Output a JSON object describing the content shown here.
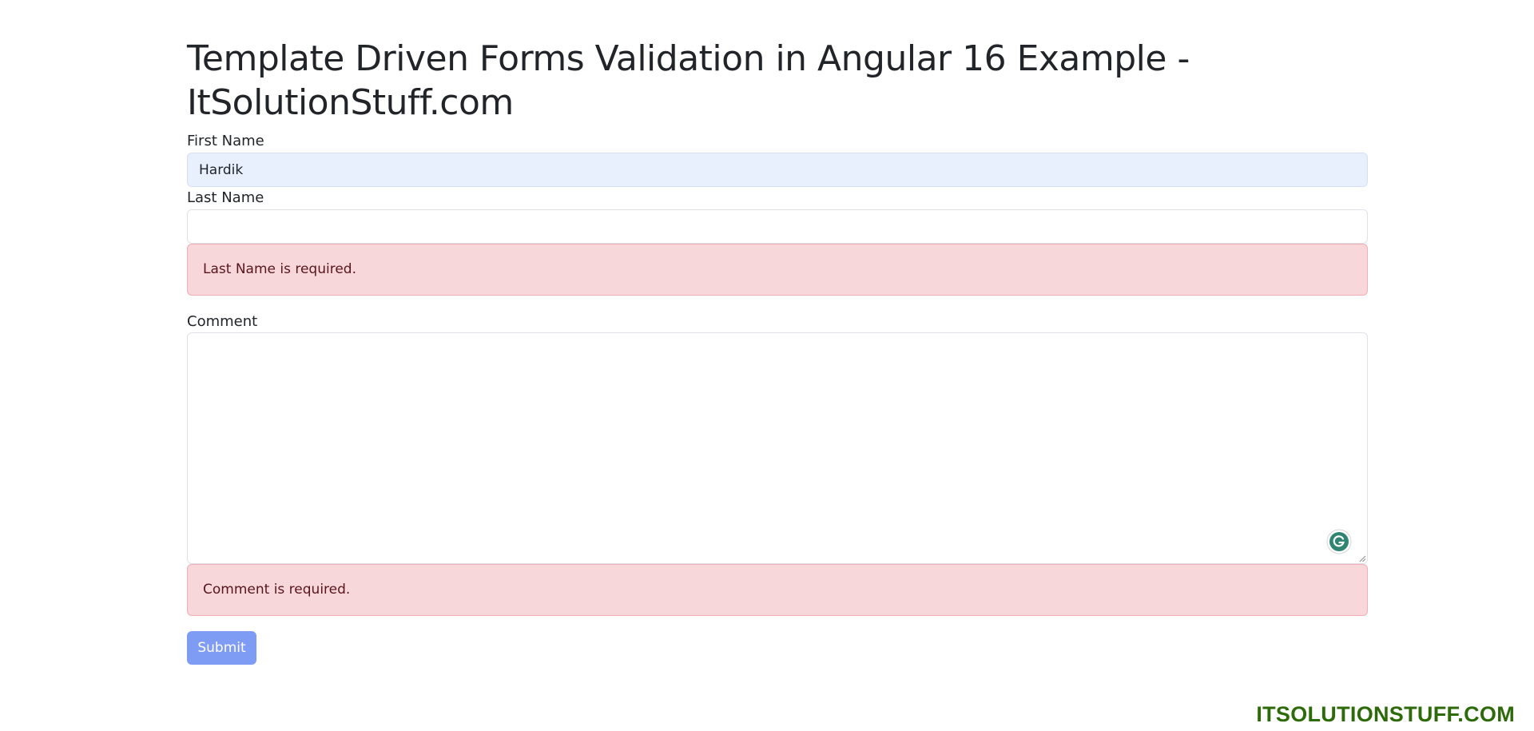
{
  "page": {
    "title": "Template Driven Forms Validation in Angular 16 Example - ItSolutionStuff.com"
  },
  "form": {
    "first_name": {
      "label": "First Name",
      "value": "Hardik",
      "placeholder": ""
    },
    "last_name": {
      "label": "Last Name",
      "value": "",
      "placeholder": "",
      "error": "Last Name is required."
    },
    "comment": {
      "label": "Comment",
      "value": "",
      "error": "Comment is required."
    },
    "submit_label": "Submit"
  },
  "watermark": {
    "text": "ITSOLUTIONSTUFF.COM",
    "color": "#2d6a0a"
  },
  "icons": {
    "grammarly": "grammarly-icon",
    "resize": "resize-handle-icon"
  },
  "colors": {
    "alert_bg": "#f8d7da",
    "alert_text": "#58151c",
    "submit_bg": "#7f9cf5",
    "autofill_bg": "#e8f0fe"
  }
}
